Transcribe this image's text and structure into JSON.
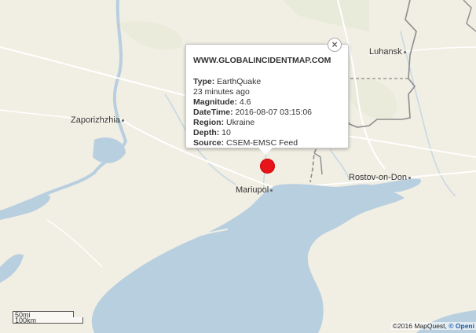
{
  "map": {
    "cities": [
      {
        "name": "Luhansk"
      },
      {
        "name": "Zaporizhzhia"
      },
      {
        "name": "Mariupol"
      },
      {
        "name": "Rostov-on-Don"
      }
    ],
    "colors": {
      "land": "#f1eee3",
      "water": "#b8cfe0",
      "border": "#8c8c8c",
      "road": "#ffffff",
      "marker": "#e8141b"
    }
  },
  "popup": {
    "site": "WWW.GLOBALINCIDENTMAP.COM",
    "type_label": "Type:",
    "type_value": "EarthQuake",
    "age": "23 minutes ago",
    "magnitude_label": "Magnitude:",
    "magnitude_value": "4.6",
    "datetime_label": "DateTime:",
    "datetime_value": "2016-08-07 03:15:06",
    "region_label": "Region:",
    "region_value": "Ukraine",
    "depth_label": "Depth:",
    "depth_value": "10",
    "source_label": "Source:",
    "source_value": "CSEM-EMSC Feed",
    "close_icon": "×"
  },
  "scale": {
    "mi": "50mi",
    "km": "100km"
  },
  "attribution": {
    "text": "©2016 MapQuest,",
    "link": "© Openi"
  }
}
